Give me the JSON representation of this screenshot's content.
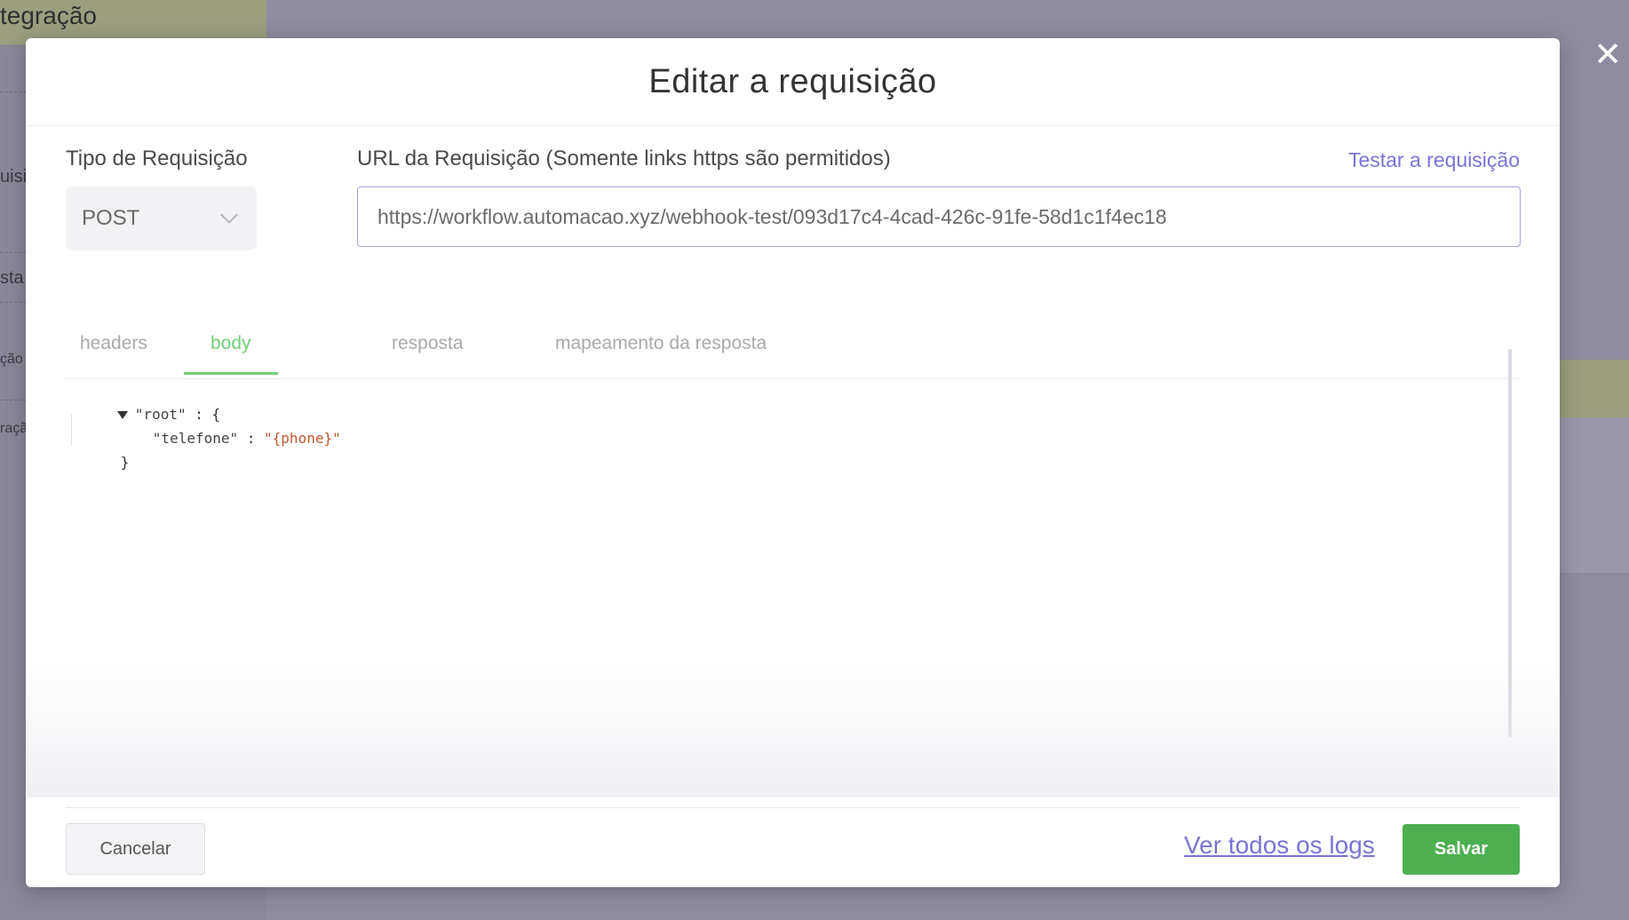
{
  "background": {
    "top_tab_label": "tegração",
    "side_fragments": [
      "uisi",
      "sta",
      "ção",
      "raçã"
    ]
  },
  "modal": {
    "title": "Editar a requisição",
    "request_type": {
      "label": "Tipo de Requisição",
      "value": "POST"
    },
    "request_url": {
      "label": "URL da Requisição (Somente links https são permitidos)",
      "value": "https://workflow.automacao.xyz/webhook-test/093d17c4-4cad-426c-91fe-58d1c1f4ec18"
    },
    "test_link": "Testar a requisição",
    "tabs": [
      {
        "label": "headers",
        "active": false
      },
      {
        "label": "body",
        "active": true
      },
      {
        "label": "resposta",
        "active": false
      },
      {
        "label": "mapeamento da resposta",
        "active": false
      }
    ],
    "body_json": {
      "root_key": "\"root\"",
      "open_brace": " : {",
      "child_key": "\"telefone\"",
      "separator": " : ",
      "child_value": "\"{phone}\"",
      "close_brace": "}"
    },
    "footer": {
      "cancel_label": "Cancelar",
      "logs_link": "Ver todos os logs",
      "save_label": "Salvar"
    }
  },
  "colors": {
    "accent_purple": "#7b73d6",
    "active_tab_green": "#6fcf74",
    "save_green": "#4caf50",
    "json_string": "#c0572e"
  },
  "icons": {
    "close": "close-icon",
    "dropdown": "chevron-down-icon",
    "collapse": "triangle-down-icon"
  }
}
